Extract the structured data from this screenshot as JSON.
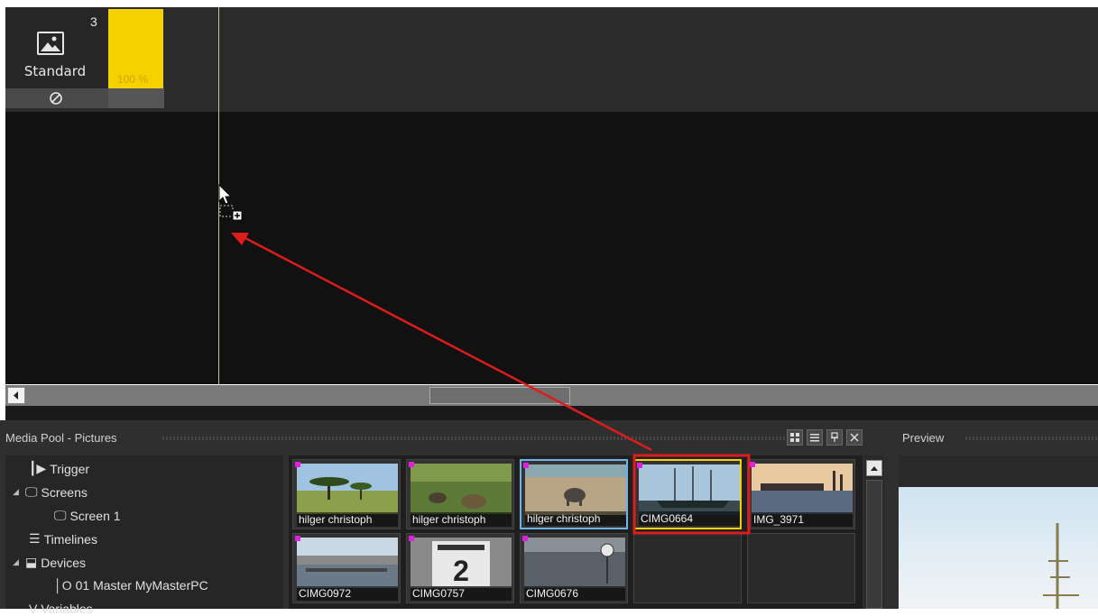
{
  "timeline": {
    "track_number": "3",
    "track_name": "Standard",
    "opacity_label": "100 %",
    "colors": {
      "opacity_bar": "#f5d100",
      "playhead": "#c8c880",
      "canvas": "#111111"
    }
  },
  "media_pool": {
    "title": "Media Pool - Pictures",
    "toolbar": {
      "grid_view": "grid-view-icon",
      "list_view": "list-view-icon",
      "pin": "pin-icon",
      "close": "close-icon"
    },
    "tree": [
      {
        "label": "Trigger",
        "icon": "trigger-icon"
      },
      {
        "label": "Screens",
        "icon": "screens-icon"
      },
      {
        "label": "Screen 1",
        "icon": "screen-icon"
      },
      {
        "label": "Timelines",
        "icon": "timelines-icon"
      },
      {
        "label": "Devices",
        "icon": "devices-icon"
      },
      {
        "label": "01 Master MyMasterPC",
        "icon": "device-icon"
      },
      {
        "label": "Variables",
        "icon": "variables-icon"
      }
    ],
    "items": [
      {
        "label": "hilger christoph",
        "thumb": "savanna-tree"
      },
      {
        "label": "hilger christoph",
        "thumb": "grass-animals"
      },
      {
        "label": "hilger christoph",
        "thumb": "elephant-beach"
      },
      {
        "label": "CIMG0664",
        "thumb": "sailing-ship"
      },
      {
        "label": "IMG_3971",
        "thumb": "harbor-sunset"
      },
      {
        "label": "CIMG0972",
        "thumb": "city-waterfront"
      },
      {
        "label": "CIMG0757",
        "thumb": "number-sign"
      },
      {
        "label": "CIMG0676",
        "thumb": "river-clock"
      }
    ],
    "colors": {
      "tag": "#e020e0",
      "highlight": "#dd1c1c",
      "selection": "#f5d100"
    }
  },
  "preview": {
    "title": "Preview"
  }
}
